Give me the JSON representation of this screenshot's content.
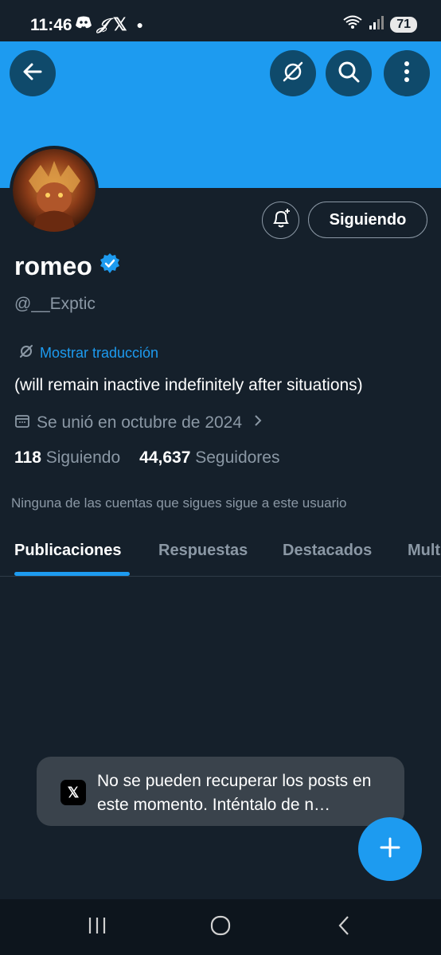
{
  "status_bar": {
    "time": "11:46",
    "icons": [
      "discord-icon",
      "tiktok-icon",
      "x-logo-icon",
      "dot-icon"
    ],
    "signal_label": "5",
    "battery": "71"
  },
  "header": {
    "back_icon": "arrow-left-icon",
    "actions": [
      "translate-off-icon",
      "search-icon",
      "more-vertical-icon"
    ],
    "banner_color": "#1d9bf0"
  },
  "profile": {
    "name": "romeo",
    "verified": true,
    "handle": "@__Exptic",
    "translate_label": "Mostrar traducción",
    "bio": "(will remain inactive indefinitely after situations)",
    "joined": "Se unió en octubre de 2024",
    "following_count": "118",
    "following_label": "Siguiendo",
    "followers_count": "44,637",
    "followers_label": "Seguidores",
    "mutual_note": "Ninguna de las cuentas que sigues sigue a este usuario",
    "follow_button": "Siguiendo"
  },
  "tabs": [
    {
      "label": "Publicaciones",
      "active": true
    },
    {
      "label": "Respuestas",
      "active": false
    },
    {
      "label": "Destacados",
      "active": false
    },
    {
      "label": "Mult",
      "active": false
    }
  ],
  "toast": {
    "text": "No se pueden recuperar los posts en este momento. Inténtalo de n…"
  },
  "fab_icon": "plus-icon",
  "accent_color": "#1d9bf0"
}
